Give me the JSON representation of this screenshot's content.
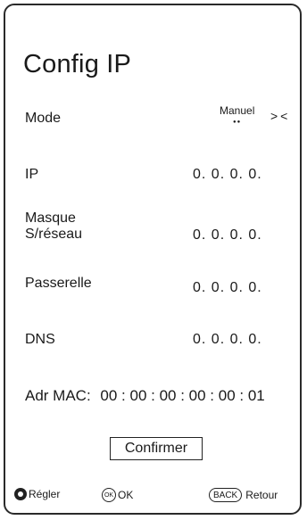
{
  "title": "Config IP",
  "rows": [
    {
      "label": "Mode",
      "value": "Manuel"
    },
    {
      "label": "IP",
      "value": "0. 0. 0. 0."
    },
    {
      "label": "Masque\nS/réseau",
      "value": "0. 0. 0. 0."
    },
    {
      "label": "Passerelle",
      "value": "0. 0. 0. 0."
    },
    {
      "label": "DNS",
      "value": "0. 0. 0. 0."
    }
  ],
  "mode": {
    "dots": "●●",
    "arrows": "><"
  },
  "mac": {
    "label": "Adr MAC:",
    "value": "00 : 00 : 00 : 00 : 00 : 01"
  },
  "confirm_label": "Confirmer",
  "footer": {
    "adjust_label": "Régler",
    "ok_icon_text": "OK",
    "ok_label": "OK",
    "back_icon_text": "BACK",
    "back_label": "Retour"
  },
  "icons": {
    "navigate": "navigate-icon",
    "ok": "ok-button-icon",
    "back": "back-button-icon",
    "mode_arrows": "left-right-arrows-icon"
  }
}
